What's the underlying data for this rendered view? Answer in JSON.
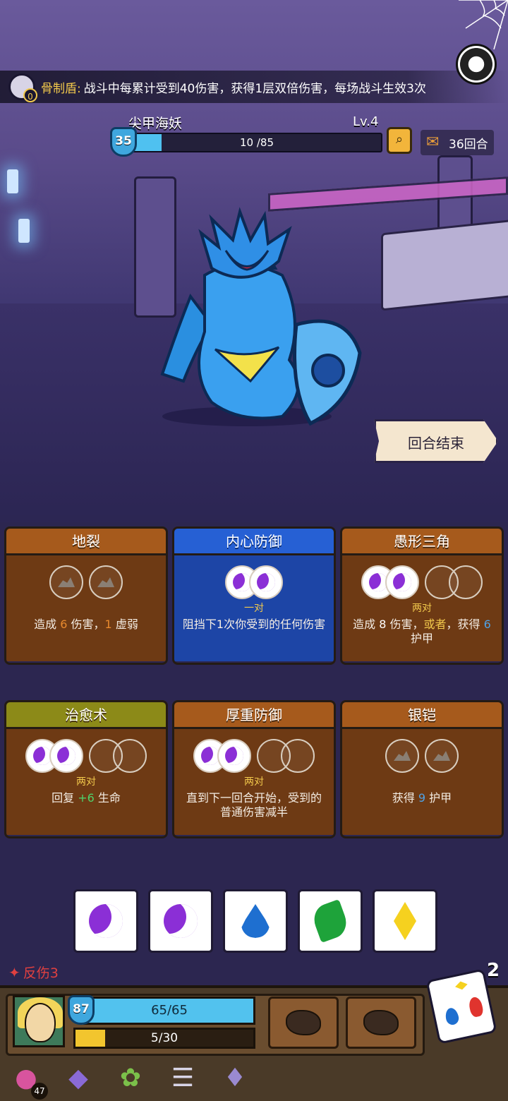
{
  "relic": {
    "name": "骨制盾:",
    "desc": "战斗中每累计受到40伤害，获得1层双倍伤害，每场战斗生效3次",
    "count": "0",
    "icon": "shield-skull-icon"
  },
  "enemy": {
    "name": "尖甲海妖",
    "level": "Lv.4",
    "armor": "35",
    "hp_text": "10 /85",
    "hp_fraction": 0.1176
  },
  "round": {
    "label": "36回合",
    "icon": "scroll-icon"
  },
  "end_turn_label": "回合结束",
  "cards": [
    {
      "title": "地裂",
      "color": "brown",
      "slots": [
        "rock",
        "rock"
      ],
      "requirement": "",
      "desc_parts": [
        "造成 ",
        "6",
        " 伤害，",
        "1",
        " 虚弱"
      ]
    },
    {
      "title": "内心防御",
      "color": "blue",
      "slots": [
        "moon",
        "moon"
      ],
      "requirement": "一对",
      "desc": "阻挡下1次你受到的任何伤害"
    },
    {
      "title": "愚形三角",
      "color": "brown",
      "slots": [
        "moon",
        "moon",
        "empty",
        "empty"
      ],
      "requirement": "两对",
      "desc_parts": [
        "造成 ",
        "8",
        " 伤害，",
        "或者",
        "，获得 ",
        "6",
        " 护甲"
      ]
    },
    {
      "title": "治愈术",
      "color": "olive",
      "slots": [
        "moon",
        "moon",
        "empty",
        "empty"
      ],
      "requirement": "两对",
      "desc_parts": [
        "回复 ",
        "+6",
        " 生命"
      ]
    },
    {
      "title": "厚重防御",
      "color": "brown",
      "slots": [
        "moon",
        "moon",
        "empty",
        "empty"
      ],
      "requirement": "两对",
      "desc": "直到下一回合开始，受到的普通伤害减半"
    },
    {
      "title": "银铠",
      "color": "brown",
      "slots": [
        "rock",
        "rock"
      ],
      "requirement": "",
      "desc_parts": [
        "获得 ",
        "9",
        " 护甲"
      ]
    }
  ],
  "dice": [
    "moon",
    "moon",
    "water",
    "leaf",
    "diamond"
  ],
  "thorns_label": "反伤3",
  "player": {
    "armor": "87",
    "hp_text": "65/65",
    "hp_fraction": 1.0,
    "xp_text": "5/30",
    "xp_fraction": 0.1667
  },
  "reroll_count": "2",
  "relic_badge": "47",
  "colors": {
    "enemy_hp": "#4fc1f0",
    "player_hp": "#52c2ee",
    "xp": "#f2c52e",
    "card_blue": "#1d45a6",
    "card_brown": "#6e3a14",
    "accent_gold": "#f2c94c"
  }
}
